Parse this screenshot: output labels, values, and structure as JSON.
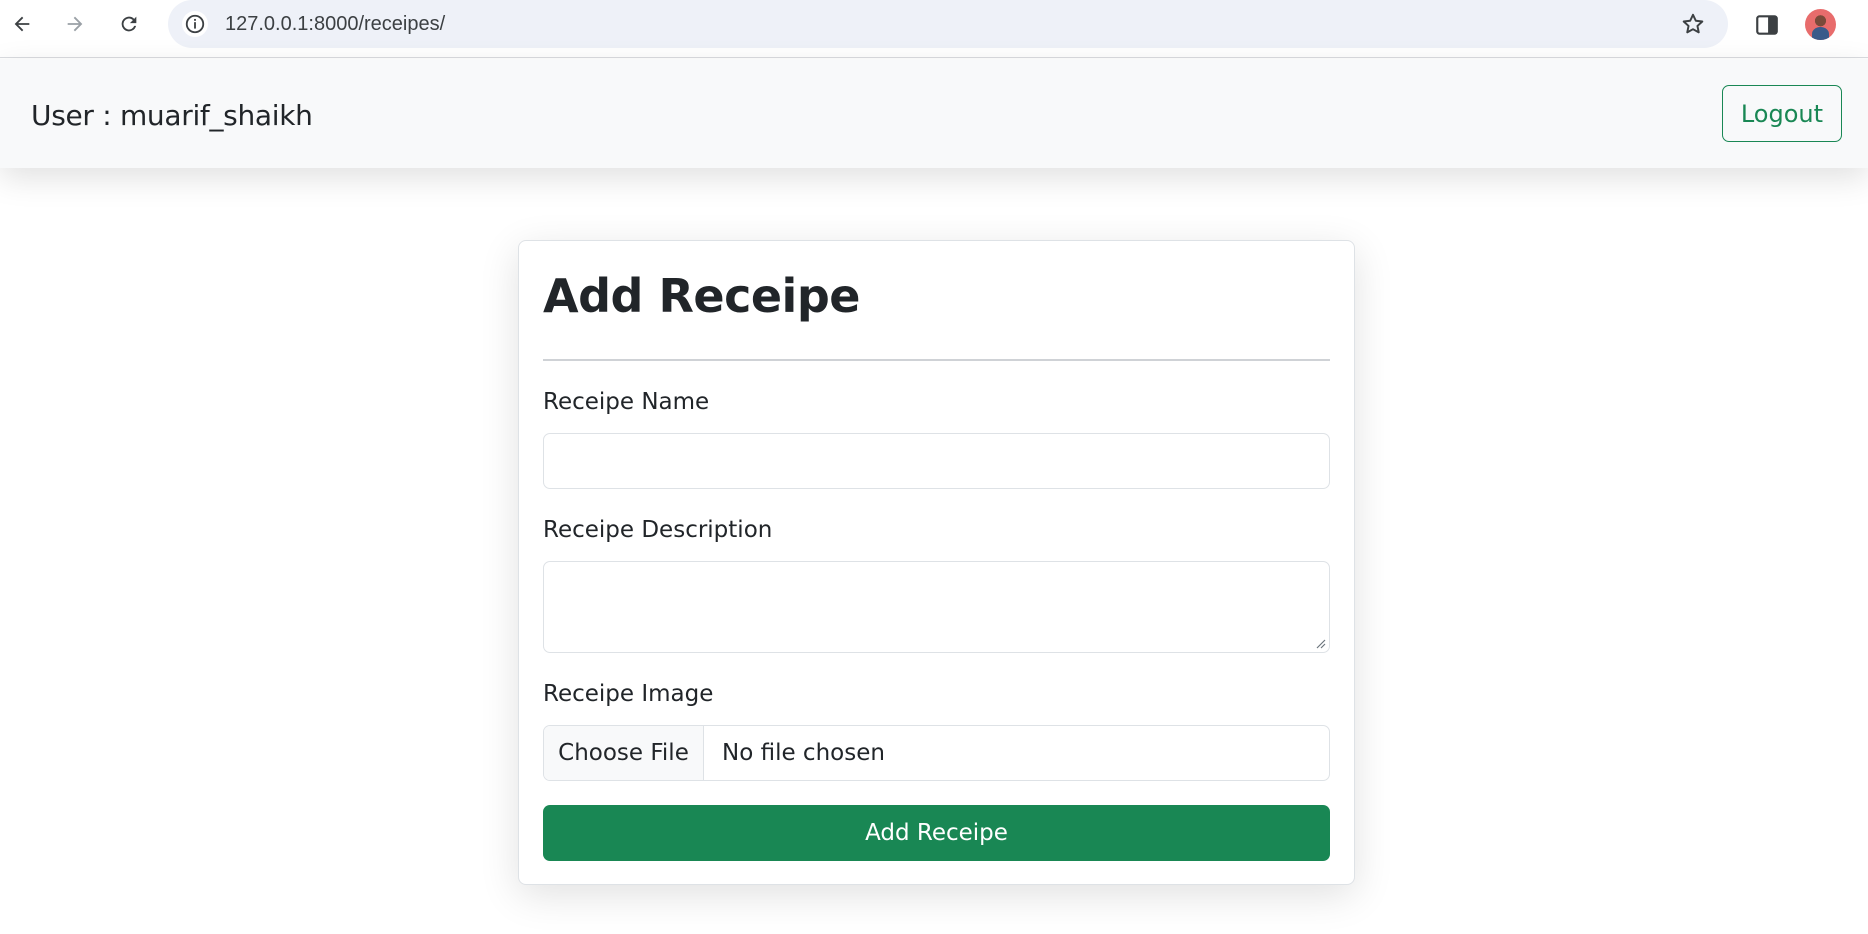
{
  "browser": {
    "url": "127.0.0.1:8000/receipes/",
    "icons": {
      "back": "arrow-left-icon",
      "forward": "arrow-right-icon",
      "reload": "reload-icon",
      "info": "info-icon",
      "bookmark": "star-icon",
      "side_panel": "side-panel-icon",
      "profile": "avatar"
    }
  },
  "navbar": {
    "user_label": "User : muarif_shaikh",
    "logout_label": "Logout"
  },
  "form": {
    "title": "Add Receipe",
    "name_label": "Receipe Name",
    "name_value": "",
    "description_label": "Receipe Description",
    "description_value": "",
    "image_label": "Receipe Image",
    "choose_file_label": "Choose File",
    "no_file_text": "No file chosen",
    "submit_label": "Add Receipe"
  },
  "colors": {
    "accent": "#198754",
    "navbar_bg": "#f8f9fa",
    "address_bar_bg": "#eef1f8"
  }
}
